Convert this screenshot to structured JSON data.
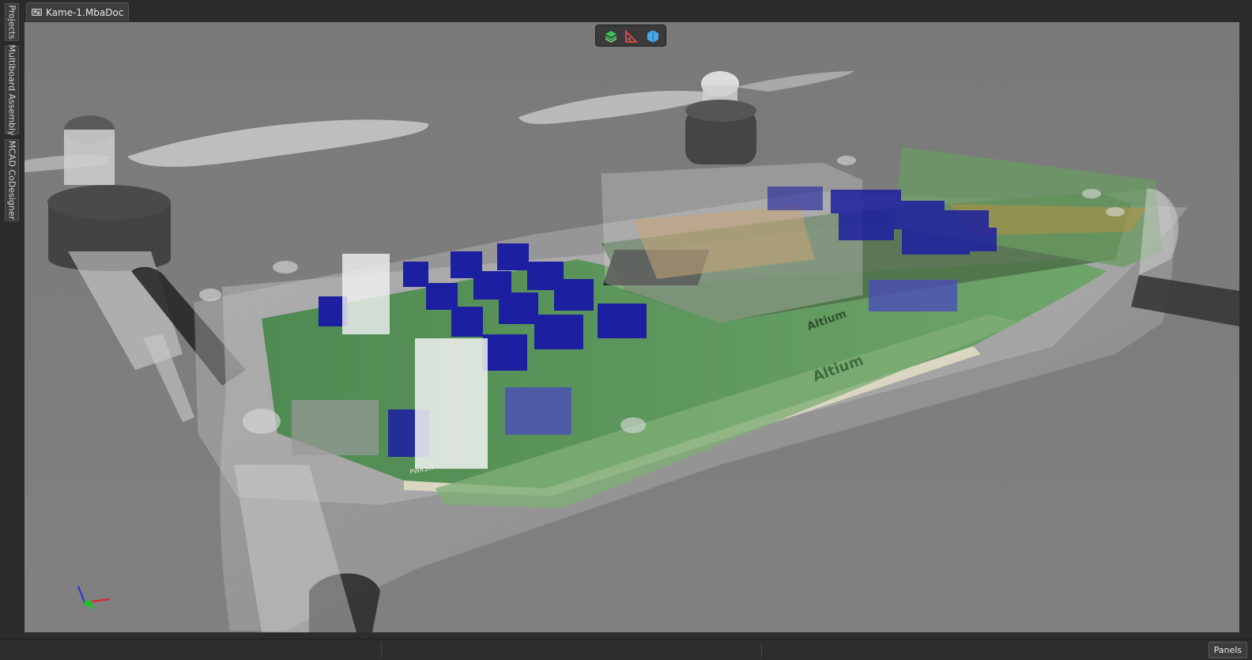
{
  "left_panels": {
    "tabs": [
      {
        "label": "Projects"
      },
      {
        "label": "Multiboard Assembly"
      },
      {
        "label": "MCAD CoDesigner"
      }
    ]
  },
  "document": {
    "tab_label": "Kame-1.MbaDoc",
    "icon": "multiboard-doc-icon"
  },
  "view_toolbar": {
    "buttons": [
      {
        "icon": "layers-icon",
        "color": "#3fbf5a"
      },
      {
        "icon": "measure-icon",
        "color": "#e04848"
      },
      {
        "icon": "view-cube-icon",
        "color": "#4aa8e8"
      }
    ]
  },
  "viewport": {
    "background": "#7d7d7d",
    "board_color": "#5f9a5c",
    "connector_color": "#1c1fa0"
  },
  "silkscreen": {
    "brand": "Altium",
    "switch_label": "PWRSW"
  },
  "axis_gizmo": {
    "x_color": "#e02020",
    "y_color": "#20c020",
    "z_color": "#2030e0"
  },
  "status_bar": {
    "panels_label": "Panels"
  }
}
